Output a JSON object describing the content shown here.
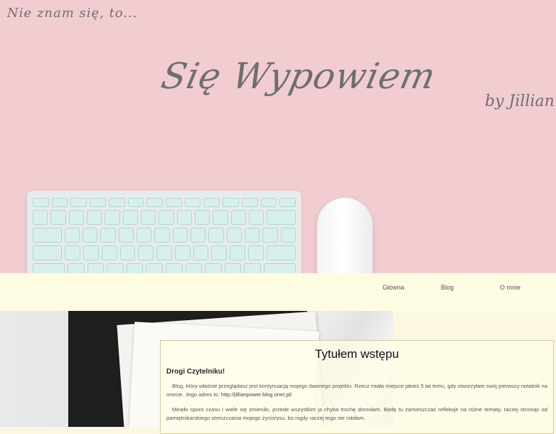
{
  "hero": {
    "tagline": "Nie znam się, to...",
    "title": "Się Wypowiem",
    "byline": "by Jillian"
  },
  "nav": {
    "items": [
      {
        "label": "Główna"
      },
      {
        "label": "Blog"
      },
      {
        "label": "O mnie"
      }
    ]
  },
  "post": {
    "title": "Tytułem wstępu",
    "greeting": "Drogi Czytelniku!",
    "paragraph1_text": "Blog, który właśnie przeglądasz jest kontynuacją mojego dawnego projektu. Rzecz miała miejsce jakieś 5 lat temu, gdy stworzyłam swój pierwszy notatnik na onecie. Jego adres to: ",
    "paragraph1_link": "http://jillianpower.blog.onet.pl/",
    "paragraph2": "Minęło sporo czasu i wiele się zmieniło, przede wszystkim ja chyba trochę dorosłam. Będę tu zamieszczać refleksje na różne tematy, raczej stroniąc od pamiętnikarskiego streszczania mojego życiorysu, bo nigdy raczej tego nie robiłam."
  },
  "colors": {
    "hero_bg": "#f1cdd1",
    "nav_bg": "#fdfbe1",
    "script_text": "#6f6e71"
  }
}
